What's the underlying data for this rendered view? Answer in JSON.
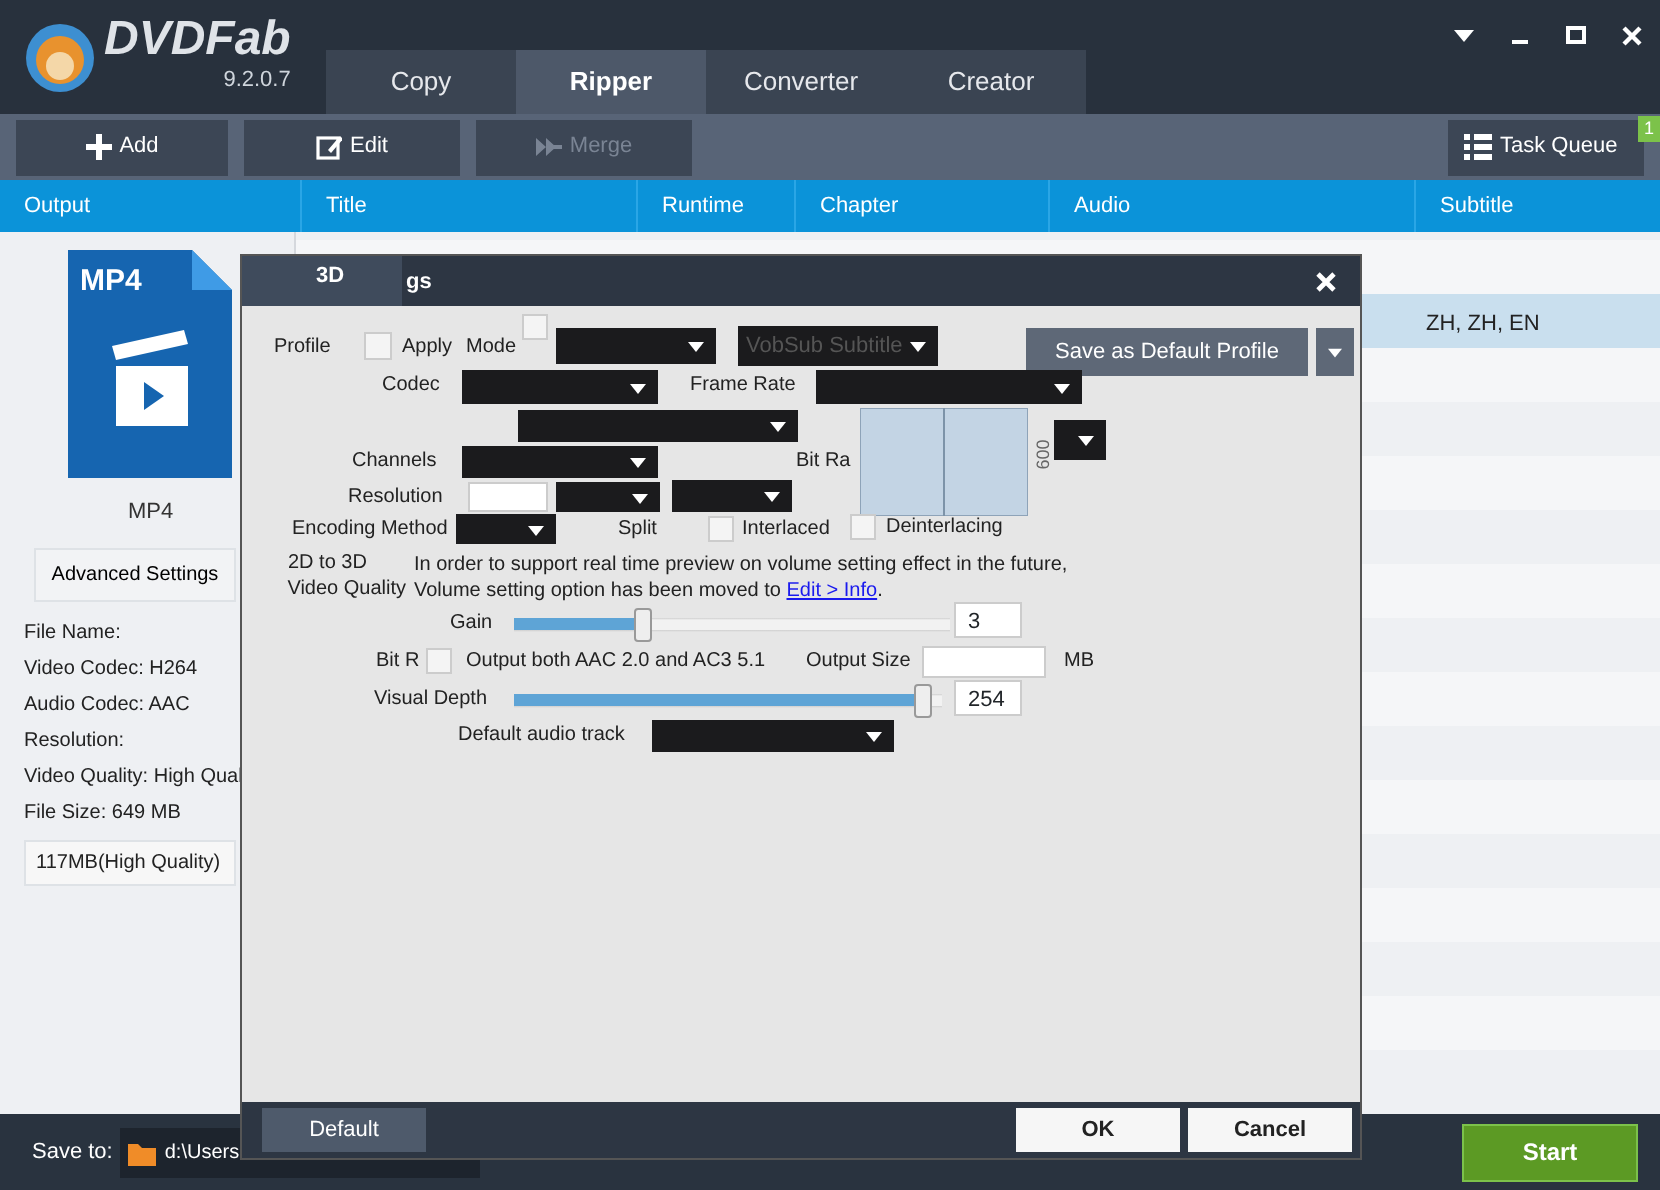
{
  "app": {
    "name": "DVDFab",
    "version": "9.2.0.7"
  },
  "window_controls": [
    {
      "kind": "menu"
    },
    {
      "kind": "minimize"
    },
    {
      "kind": "maximize"
    },
    {
      "kind": "close"
    }
  ],
  "tabs": [
    {
      "label": "Copy",
      "selected": false
    },
    {
      "label": "Ripper",
      "selected": true
    },
    {
      "label": "Converter",
      "selected": false
    },
    {
      "label": "Creator",
      "selected": false
    }
  ],
  "toolbar": [
    {
      "label": "Add",
      "kind": "add",
      "disabled": false
    },
    {
      "label": "Edit",
      "kind": "edit",
      "disabled": false
    },
    {
      "label": "Merge",
      "kind": "merge",
      "disabled": true
    }
  ],
  "task_queue": {
    "label": "Task Queue",
    "count": "1"
  },
  "table": {
    "columns": [
      "Output",
      "Title",
      "Runtime",
      "Chapter",
      "Audio",
      "Subtitle"
    ],
    "rows": [
      {
        "subtitle": "ZH, ZH, EN",
        "selected": true
      }
    ]
  },
  "output": {
    "badge": "MP4",
    "format": "MP4",
    "advanced_button": "Advanced Settings",
    "info": [
      "File Name:",
      "Video Codec: H264",
      "Audio Codec: AAC",
      "Resolution:",
      "Video Quality: High Qual",
      "File Size: 649 MB"
    ],
    "size_option": "117MB(High Quality)"
  },
  "save_to": {
    "label": "Save to:",
    "path": "d:\\Users"
  },
  "start_button": "Start",
  "dialog": {
    "tab": "3D",
    "title": "gs",
    "items": [
      {
        "kind": "label",
        "text": "Profile"
      },
      {
        "kind": "checkbox",
        "checked": false
      },
      {
        "kind": "label",
        "text": "Apply"
      },
      {
        "kind": "label",
        "text": "Mode"
      },
      {
        "kind": "checkbox",
        "checked": false
      },
      {
        "kind": "dropdown"
      },
      {
        "kind": "dropdown",
        "text": "VobSub Subtitle"
      },
      {
        "kind": "split_button",
        "label": "Save as Default Profile"
      },
      {
        "kind": "label",
        "text": "Codec"
      },
      {
        "kind": "dropdown"
      },
      {
        "kind": "label",
        "text": "Frame Rate"
      },
      {
        "kind": "dropdown"
      },
      {
        "kind": "dropdown"
      },
      {
        "kind": "label",
        "text": "Channels"
      },
      {
        "kind": "dropdown"
      },
      {
        "kind": "label",
        "text": "Bit Ra"
      },
      {
        "kind": "dropdown"
      },
      {
        "kind": "preview",
        "axis_label": "600"
      },
      {
        "kind": "label",
        "text": "Resolution"
      },
      {
        "kind": "input"
      },
      {
        "kind": "dropdown"
      },
      {
        "kind": "dropdown"
      },
      {
        "kind": "label",
        "text": "Encoding Method"
      },
      {
        "kind": "dropdown"
      },
      {
        "kind": "label",
        "text": "Split"
      },
      {
        "kind": "checkbox",
        "checked": false
      },
      {
        "kind": "label",
        "text": "Interlaced"
      },
      {
        "kind": "checkbox",
        "checked": false
      },
      {
        "kind": "label",
        "text": "Deinterlacing"
      },
      {
        "kind": "label",
        "text": "2D to 3D"
      },
      {
        "kind": "label",
        "text": "Video Quality"
      },
      {
        "kind": "note",
        "before": "In order to support real time preview on volume setting effect in the future, Volume setting option has been moved to ",
        "link": "Edit > Info",
        "after": "."
      },
      {
        "kind": "label",
        "text": "Gain"
      },
      {
        "kind": "slider",
        "level": 0.3
      },
      {
        "kind": "input",
        "value": "3"
      },
      {
        "kind": "label",
        "text": "Bit R"
      },
      {
        "kind": "checkbox",
        "checked": false
      },
      {
        "kind": "label",
        "text": "Output both AAC 2.0 and AC3 5.1"
      },
      {
        "kind": "label",
        "text": "Output Size"
      },
      {
        "kind": "input"
      },
      {
        "kind": "label",
        "text": "MB"
      },
      {
        "kind": "label",
        "text": "Visual Depth"
      },
      {
        "kind": "slider",
        "level": 0.96
      },
      {
        "kind": "input",
        "value": "254"
      },
      {
        "kind": "label",
        "text": "Default audio track"
      },
      {
        "kind": "dropdown"
      }
    ],
    "footer_buttons": [
      {
        "label": "Default",
        "kind": "secondary"
      },
      {
        "label": "OK",
        "kind": "primary"
      },
      {
        "label": "Cancel",
        "kind": "primary"
      }
    ]
  }
}
